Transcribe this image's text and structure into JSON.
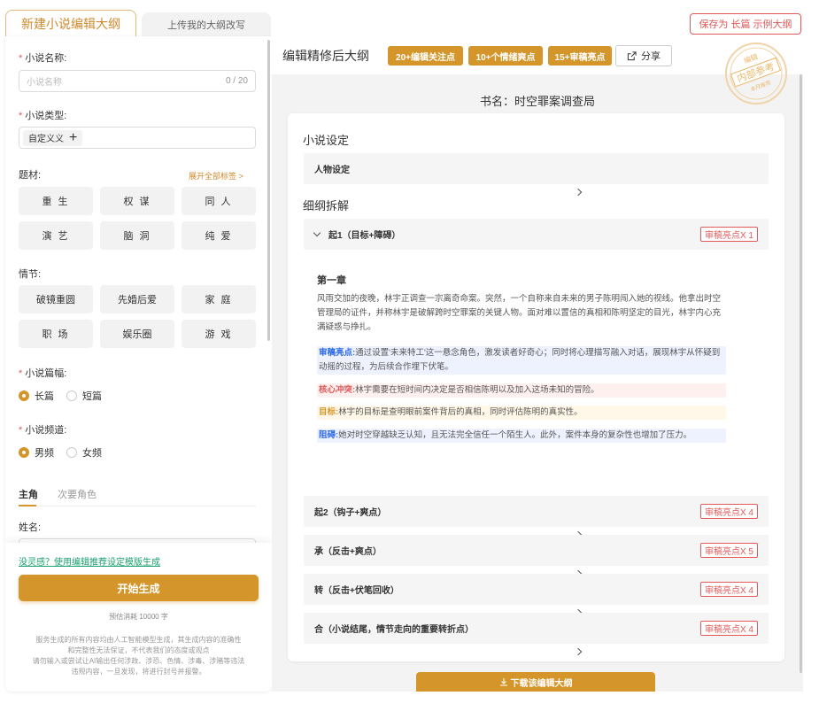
{
  "tabs": {
    "active": "新建小说编辑大纲",
    "inactive": "上传我的大纲改写"
  },
  "save_button": "保存为 长篇 示例大纲",
  "form": {
    "name_label": "小说名称:",
    "name_placeholder": "小说名称",
    "name_count": "0 / 20",
    "type_label": "小说类型:",
    "type_tag": "自定义义",
    "theme_label": "题材:",
    "expand_link": "展开全部标签 >",
    "themes": [
      "重 生",
      "权 谋",
      "同 人",
      "演 艺",
      "脑 洞",
      "纯 爱"
    ],
    "plot_label": "情节:",
    "plots": [
      "破镜重圆",
      "先婚后爱",
      "家 庭",
      "职 场",
      "娱乐圈",
      "游 戏"
    ],
    "length_label": "小说篇幅:",
    "length_options": [
      "长篇",
      "短篇"
    ],
    "channel_label": "小说频道:",
    "channel_options": [
      "男频",
      "女频"
    ],
    "role_tabs": [
      "主角",
      "次要角色"
    ],
    "role_name_label": "姓名:"
  },
  "bottom": {
    "hint_link": "没灵感？使用编辑推荐设定模版生成",
    "start_button": "开始生成",
    "cost": "预估消耗 10000 字",
    "disclaimer": [
      "服务生成的所有内容均由人工智能模型生成，其生成内容的准确性",
      "和完整性无法保证，不代表我们的态度或观点",
      "请勿输入或尝试让AI输出任何涉政、涉恐、色情、涉毒、涉赌等违法",
      "违规内容，一旦发现，将进行封号并报警。"
    ]
  },
  "right": {
    "title": "编辑精修后大纲",
    "badges": [
      "20+编辑关注点",
      "10+个情绪爽点",
      "15+审稿亮点"
    ],
    "share": "分享",
    "book_title": "书名：时空罪案调查局",
    "setting_title": "小说设定",
    "character_row": "人物设定",
    "outline_title": "细纲拆解",
    "sections": [
      {
        "label": "起1（目标+障碍）",
        "badge": "审稿亮点X 1"
      },
      {
        "label": "起2（钩子+爽点）",
        "badge": "审稿亮点X 4"
      },
      {
        "label": "承（反击+爽点）",
        "badge": "审稿亮点X 5"
      },
      {
        "label": "转（反击+伏笔回收）",
        "badge": "审稿亮点X 4"
      },
      {
        "label": "合（小说结尾，情节走向的重要转折点）",
        "badge": "审稿亮点X 4"
      }
    ],
    "chapter_title": "第一章",
    "chapter_text": "风雨交加的夜晚，林宇正调查一宗离奇命案。突然，一个自称来自未来的男子陈明闯入她的视线。他拿出时空管理局的证件，并称林宇是破解跨时空罪案的关键人物。面对难以置信的真相和陈明坚定的目光，林宇内心充满疑惑与挣扎。",
    "notes": [
      {
        "key": "审稿亮点:",
        "text": "通过设置'未来特工'这一悬念角色，激发读者好奇心；同时将心理描写融入对话，展现林宇从怀疑到动摇的过程，为后续合作埋下伏笔。"
      },
      {
        "key": "核心冲突:",
        "text": "林宇需要在短时间内决定是否相信陈明以及加入这场未知的冒险。"
      },
      {
        "key": "目标:",
        "text": "林宇的目标是查明眼前案件背后的真相，同时评估陈明的真实性。"
      },
      {
        "key": "阻碍:",
        "text": "她对时空穿越缺乏认知，且无法完全信任一个陌生人。此外，案件本身的复杂性也增加了压力。"
      }
    ],
    "download": "下载该编辑大纲"
  },
  "stamp": {
    "top": "编辑",
    "middle": "内部参考",
    "bottom": "本月推荐"
  },
  "colors": {
    "accent": "#d4962b",
    "danger": "#e15959",
    "link": "#1aa06e",
    "note_blue": "#2e6be6"
  }
}
